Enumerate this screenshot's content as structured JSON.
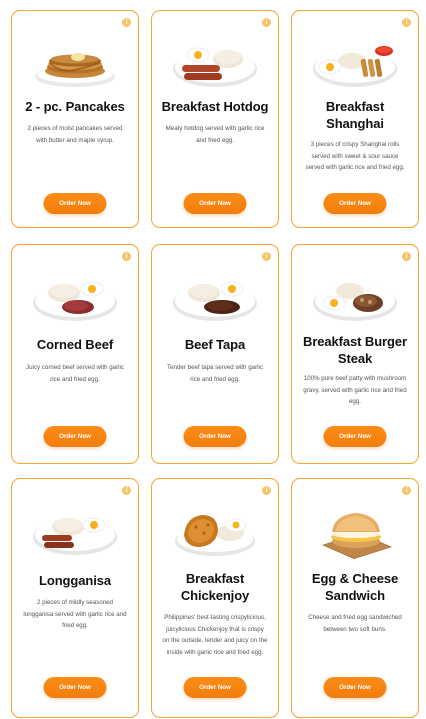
{
  "colors": {
    "accent": "#f58410",
    "card_border": "#f3a52d",
    "info_dot": "#f9c365"
  },
  "menu": {
    "items": [
      {
        "title": "2 - pc. Pancakes",
        "description": "2 pieces of moist pancakes served with butter and maple syrup.",
        "button": "Order Now",
        "icon": "pancakes-photo"
      },
      {
        "title": "Breakfast Hotdog",
        "description": "Meaty hotdog served with garlic rice and fried egg.",
        "button": "Order Now",
        "icon": "hotdog-plate-photo"
      },
      {
        "title": "Breakfast Shanghai",
        "description": "3 pieces of crispy Shanghai rolls served with sweet & sour sauce served with garlic rice and fried egg.",
        "button": "Order Now",
        "icon": "shanghai-plate-photo"
      },
      {
        "title": "Corned Beef",
        "description": "Juicy corned beef served with garlic rice and fried egg.",
        "button": "Order Now",
        "icon": "corned-beef-plate-photo"
      },
      {
        "title": "Beef Tapa",
        "description": "Tender beef tapa served with garlic rice and fried egg.",
        "button": "Order Now",
        "icon": "beef-tapa-plate-photo"
      },
      {
        "title": "Breakfast Burger Steak",
        "description": "100% pure beef patty with mushroom gravy, served with garlic rice and fried egg.",
        "button": "Order Now",
        "icon": "burger-steak-plate-photo"
      },
      {
        "title": "Longganisa",
        "description": "2 pieces of mildly seasoned longganisa served with garlic rice and fried egg.",
        "button": "Order Now",
        "icon": "longganisa-plate-photo"
      },
      {
        "title": "Breakfast Chickenjoy",
        "description": "Philippines' best-tasting crispylicious, juicylicious Chickenjoy that is crispy on the outside, tender and juicy on the inside with garlic rice and fried egg.",
        "button": "Order Now",
        "icon": "chickenjoy-plate-photo"
      },
      {
        "title": "Egg & Cheese Sandwich",
        "description": "Cheese and fried egg sandwiched between two soft buns.",
        "button": "Order Now",
        "icon": "egg-cheese-sandwich-photo"
      }
    ]
  }
}
